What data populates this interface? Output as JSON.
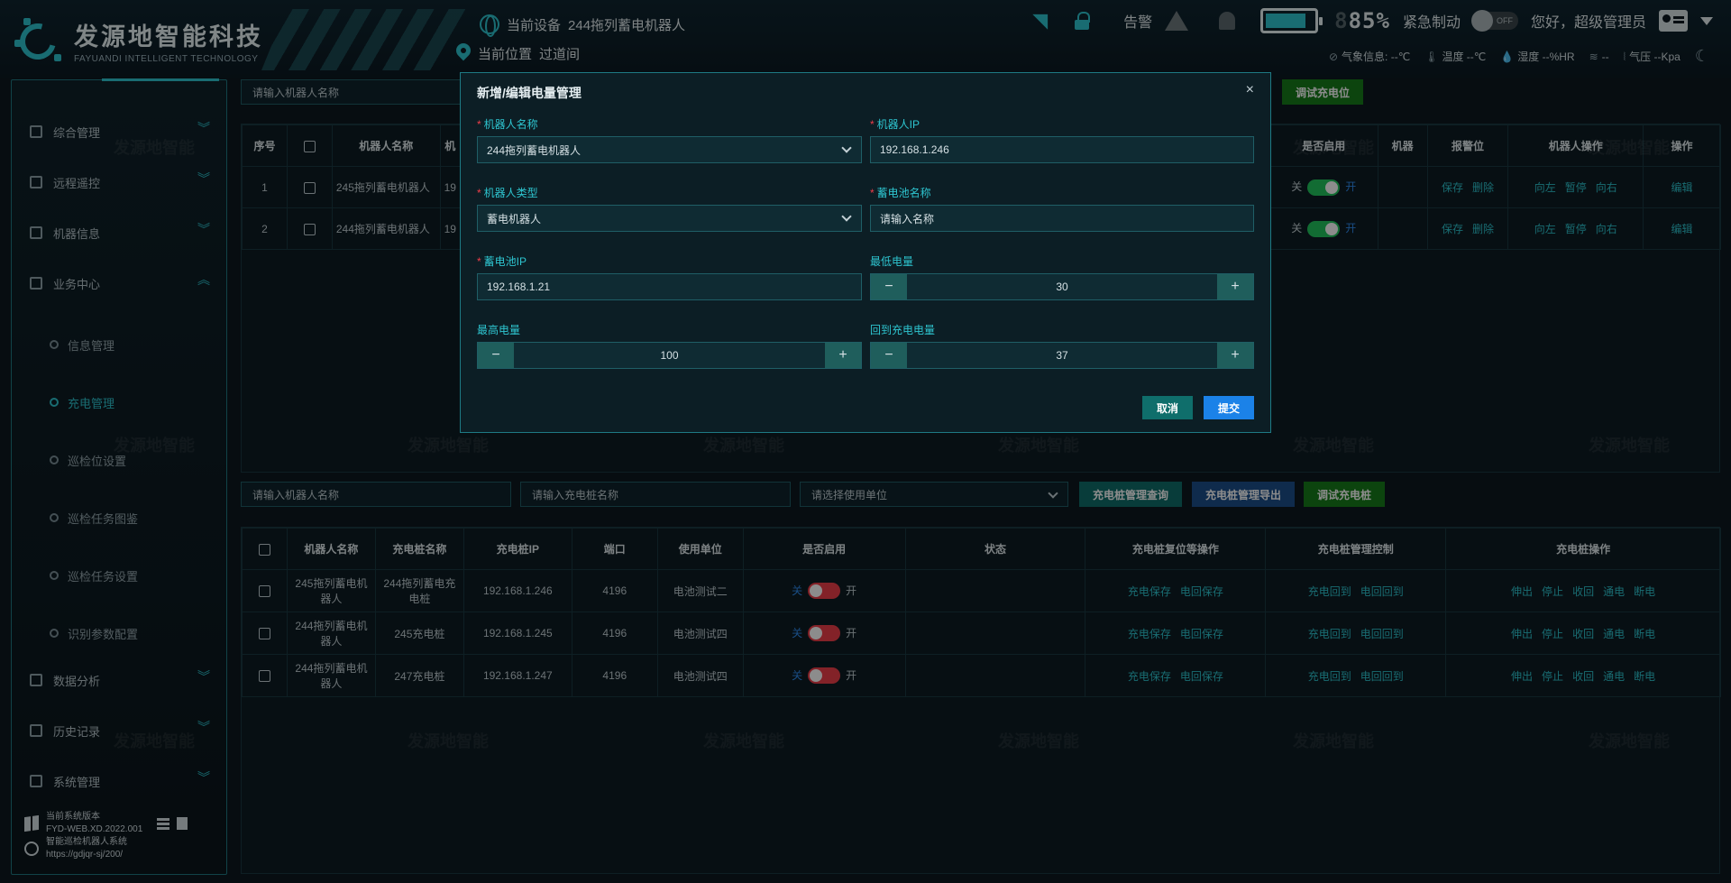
{
  "header": {
    "logo_cn": "发源地智能科技",
    "logo_en": "FAYUANDI INTELLIGENT TECHNOLOGY",
    "device_label": "当前设备",
    "device_value": "244拖列蓄电机器人",
    "location_label": "当前位置",
    "location_value": "过道间",
    "alarm_label": "告警",
    "battery_pct": "85%",
    "battery_prefix": "8",
    "estop_label": "紧急制动",
    "estop_state": "OFF",
    "greeting": "您好，",
    "user_name": "超级管理员",
    "weather": {
      "weather_label": "气象信息:",
      "weather_value": "--℃",
      "temp_label": "温度",
      "temp_value": "--℃",
      "humidity_label": "湿度",
      "humidity_value": "--%HR",
      "wind_value": "--",
      "pressure_label": "气压",
      "pressure_value": "--Kpa"
    },
    "colors": {
      "accent": "#2ec5d0",
      "danger": "#ef3e4a",
      "success": "#22c55e"
    }
  },
  "sidebar": {
    "items": [
      {
        "label": "综合管理",
        "icon": "dashboard-icon"
      },
      {
        "label": "远程遥控",
        "icon": "monitor-icon"
      },
      {
        "label": "机器信息",
        "icon": "robot-info-icon"
      },
      {
        "label": "业务中心",
        "icon": "business-icon"
      }
    ],
    "sub_items": [
      {
        "label": "信息管理"
      },
      {
        "label": "充电管理"
      },
      {
        "label": "巡检位设置"
      },
      {
        "label": "巡检任务图鉴"
      },
      {
        "label": "巡检任务设置"
      },
      {
        "label": "识别参数配置"
      }
    ],
    "bottom_items": [
      {
        "label": "数据分析",
        "icon": "analysis-icon"
      },
      {
        "label": "历史记录",
        "icon": "history-icon"
      },
      {
        "label": "系统管理",
        "icon": "settings-icon"
      }
    ],
    "sys": {
      "version_label": "当前系统版本",
      "version": "FYD-WEB.XD.2022.001",
      "system_name": "智能巡检机器人系统",
      "url": "https://gdjqr-sj/200/"
    }
  },
  "top_panel": {
    "search_placeholder": "请输入机器人名称",
    "debug_button": "调试充电位",
    "columns": [
      "序号",
      "",
      "机器人名称",
      "机",
      "",
      "",
      "",
      "",
      "",
      "",
      "",
      "",
      "",
      "",
      "是否启用",
      "机器",
      "报警位",
      "机器人操作",
      "操作"
    ],
    "rows": [
      {
        "index": "1",
        "name": "245拖列蓄电机器人",
        "ip": "19",
        "enable_off": "关",
        "enable_on": "开",
        "ops1": [
          "保存",
          "删除"
        ],
        "ops2": [
          "向左",
          "暂停",
          "向右"
        ],
        "edit": "编辑"
      },
      {
        "index": "2",
        "name": "244拖列蓄电机器人",
        "ip": "19",
        "enable_off": "关",
        "enable_on": "开",
        "ops1": [
          "保存",
          "删除"
        ],
        "ops2": [
          "向左",
          "暂停",
          "向右"
        ],
        "edit": "编辑"
      }
    ]
  },
  "bottom_panel": {
    "robot_placeholder": "请输入机器人名称",
    "pile_placeholder": "请输入充电桩名称",
    "unit_placeholder": "请选择使用单位",
    "query_button": "充电桩管理查询",
    "export_button": "充电桩管理导出",
    "debug_button": "调试充电桩",
    "columns": [
      "",
      "机器人名称",
      "充电桩名称",
      "充电桩IP",
      "端口",
      "使用单位",
      "是否启用",
      "状态",
      "充电桩复位等操作",
      "充电桩管理控制",
      "充电桩操作"
    ],
    "rows": [
      {
        "robot": "245拖列蓄电机器人",
        "pile": "244拖列蓄电充电桩",
        "ip": "192.168.1.246",
        "port": "4196",
        "unit": "电池测试二",
        "off": "关",
        "on": "开",
        "a": [
          "充电保存",
          "电回保存"
        ],
        "b": [
          "充电回到",
          "电回回到"
        ],
        "c": [
          "伸出",
          "停止",
          "收回",
          "通电",
          "断电"
        ]
      },
      {
        "robot": "244拖列蓄电机器人",
        "pile": "245充电桩",
        "ip": "192.168.1.245",
        "port": "4196",
        "unit": "电池测试四",
        "off": "关",
        "on": "开",
        "a": [
          "充电保存",
          "电回保存"
        ],
        "b": [
          "充电回到",
          "电回回到"
        ],
        "c": [
          "伸出",
          "停止",
          "收回",
          "通电",
          "断电"
        ]
      },
      {
        "robot": "244拖列蓄电机器人",
        "pile": "247充电桩",
        "ip": "192.168.1.247",
        "port": "4196",
        "unit": "电池测试四",
        "off": "关",
        "on": "开",
        "a": [
          "充电保存",
          "电回保存"
        ],
        "b": [
          "充电回到",
          "电回回到"
        ],
        "c": [
          "伸出",
          "停止",
          "收回",
          "通电",
          "断电"
        ]
      }
    ]
  },
  "watermark": "发源地智能",
  "modal": {
    "title": "新增/编辑电量管理",
    "close": "×",
    "robot_name_label": "机器人名称",
    "robot_name_value": "244拖列蓄电机器人",
    "robot_ip_label": "机器人IP",
    "robot_ip_value": "192.168.1.246",
    "robot_type_label": "机器人类型",
    "robot_type_value": "蓄电机器人",
    "pile_name_label": "蓄电池名称",
    "pile_name_placeholder": "请输入名称",
    "pile_ip_label": "蓄电池IP",
    "pile_ip_value": "192.168.1.21",
    "min_power_label": "最低电量",
    "min_power_value": "30",
    "max_power_label": "最高电量",
    "max_power_value": "100",
    "return_power_label": "回到充电电量",
    "return_power_value": "37",
    "cancel": "取消",
    "submit": "提交"
  }
}
